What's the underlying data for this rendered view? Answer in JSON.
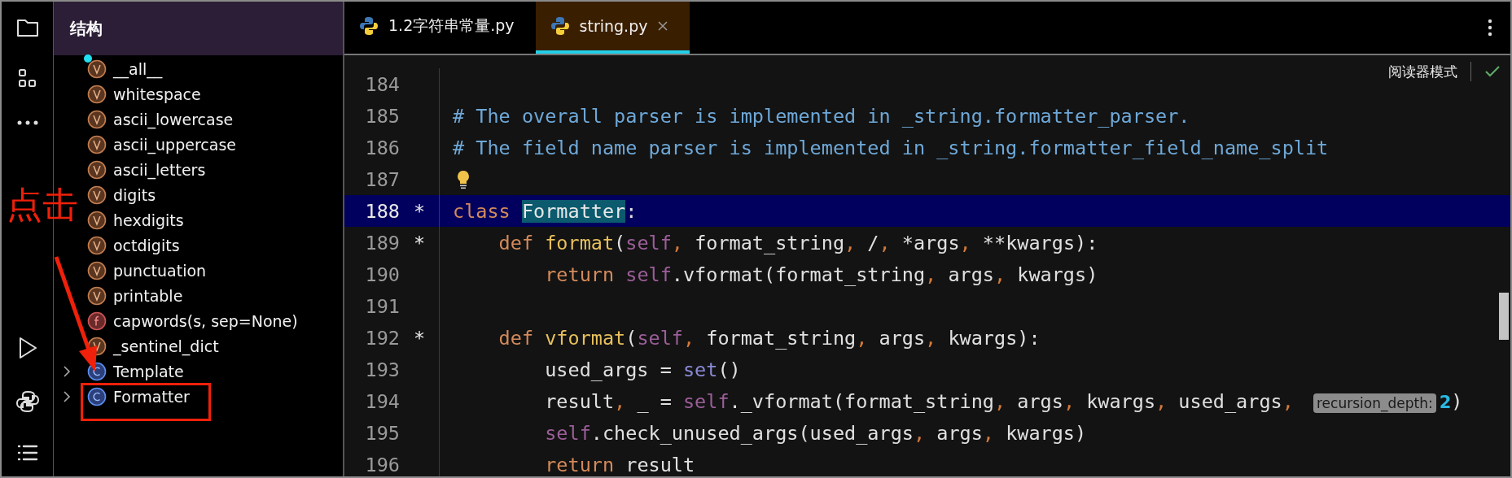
{
  "activity_bar": [
    {
      "kind": "folder"
    },
    {
      "kind": "structure"
    },
    {
      "kind": "more"
    },
    {
      "kind": "run"
    },
    {
      "kind": "python"
    },
    {
      "kind": "list"
    }
  ],
  "structure_panel": {
    "title": "结构",
    "items": [
      {
        "kind": "variable",
        "label": "__all__",
        "marked": true
      },
      {
        "kind": "variable",
        "label": "whitespace",
        "marked": false
      },
      {
        "kind": "variable",
        "label": "ascii_lowercase",
        "marked": false
      },
      {
        "kind": "variable",
        "label": "ascii_uppercase",
        "marked": false
      },
      {
        "kind": "variable",
        "label": "ascii_letters",
        "marked": false
      },
      {
        "kind": "variable",
        "label": "digits",
        "marked": false
      },
      {
        "kind": "variable",
        "label": "hexdigits",
        "marked": false
      },
      {
        "kind": "variable",
        "label": "octdigits",
        "marked": false
      },
      {
        "kind": "variable",
        "label": "punctuation",
        "marked": false
      },
      {
        "kind": "variable",
        "label": "printable",
        "marked": false
      },
      {
        "kind": "function",
        "label": "capwords(s, sep=None)",
        "marked": false
      },
      {
        "kind": "variable",
        "label": "_sentinel_dict",
        "marked": false
      },
      {
        "kind": "class",
        "label": "Template",
        "marked": false,
        "expanded": false
      },
      {
        "kind": "class",
        "label": "Formatter",
        "marked": false,
        "expanded": false
      }
    ]
  },
  "tabs": [
    {
      "label": "1.2字符串常量.py",
      "selected": false
    },
    {
      "label": "string.py",
      "selected": true
    }
  ],
  "reader_mode": {
    "label": "阅读器模式"
  },
  "code_lines": [
    {
      "number": "184",
      "current": false,
      "bulb": false
    },
    {
      "number": "185",
      "current": false,
      "bulb": false,
      "segments": [
        {
          "kind": "comment",
          "text": "# The overall parser is implemented in _string.formatter_parser."
        }
      ]
    },
    {
      "number": "186",
      "current": false,
      "bulb": false,
      "segments": [
        {
          "kind": "comment",
          "text": "# The field name parser is implemented in _string.formatter_field_name_split"
        }
      ]
    },
    {
      "number": "187",
      "current": false,
      "bulb": true
    },
    {
      "number": "188",
      "marker": "*",
      "current": true,
      "bulb": false,
      "segments": [
        {
          "kind": "keyword",
          "text": "class "
        },
        {
          "kind": "match",
          "text": "Formatter"
        },
        {
          "kind": "plain",
          "text": ":"
        }
      ]
    },
    {
      "number": "189",
      "marker": "*",
      "current": false,
      "bulb": false,
      "segments": [
        {
          "kind": "keyword",
          "text": "    def "
        },
        {
          "kind": "func",
          "text": "format"
        },
        {
          "kind": "plain",
          "text": "("
        },
        {
          "kind": "self",
          "text": "self"
        },
        {
          "kind": "punct",
          "text": ", "
        },
        {
          "kind": "plain",
          "text": "format_string"
        },
        {
          "kind": "punct",
          "text": ", "
        },
        {
          "kind": "plain",
          "text": "/"
        },
        {
          "kind": "punct",
          "text": ", "
        },
        {
          "kind": "plain",
          "text": "*args"
        },
        {
          "kind": "punct",
          "text": ", "
        },
        {
          "kind": "plain",
          "text": "**kwargs):"
        }
      ]
    },
    {
      "number": "190",
      "current": false,
      "bulb": false,
      "segments": [
        {
          "kind": "keyword",
          "text": "        return "
        },
        {
          "kind": "self",
          "text": "self"
        },
        {
          "kind": "plain",
          "text": ".vformat(format_string"
        },
        {
          "kind": "punct",
          "text": ", "
        },
        {
          "kind": "plain",
          "text": "args"
        },
        {
          "kind": "punct",
          "text": ", "
        },
        {
          "kind": "plain",
          "text": "kwargs)"
        }
      ]
    },
    {
      "number": "191",
      "current": false,
      "bulb": false
    },
    {
      "number": "192",
      "marker": "*",
      "current": false,
      "bulb": false,
      "segments": [
        {
          "kind": "keyword",
          "text": "    def "
        },
        {
          "kind": "func",
          "text": "vformat"
        },
        {
          "kind": "plain",
          "text": "("
        },
        {
          "kind": "self",
          "text": "self"
        },
        {
          "kind": "punct",
          "text": ", "
        },
        {
          "kind": "plain",
          "text": "format_string"
        },
        {
          "kind": "punct",
          "text": ", "
        },
        {
          "kind": "plain",
          "text": "args"
        },
        {
          "kind": "punct",
          "text": ", "
        },
        {
          "kind": "plain",
          "text": "kwargs):"
        }
      ]
    },
    {
      "number": "193",
      "current": false,
      "bulb": false,
      "segments": [
        {
          "kind": "plain",
          "text": "        used_args = "
        },
        {
          "kind": "builtin",
          "text": "set"
        },
        {
          "kind": "plain",
          "text": "()"
        }
      ]
    },
    {
      "number": "194",
      "current": false,
      "bulb": false,
      "segments": [
        {
          "kind": "plain",
          "text": "        result"
        },
        {
          "kind": "punct",
          "text": ", "
        },
        {
          "kind": "plain",
          "text": "_ = "
        },
        {
          "kind": "self",
          "text": "self"
        },
        {
          "kind": "plain",
          "text": "._vformat(format_string"
        },
        {
          "kind": "punct",
          "text": ", "
        },
        {
          "kind": "plain",
          "text": "args"
        },
        {
          "kind": "punct",
          "text": ", "
        },
        {
          "kind": "plain",
          "text": "kwargs"
        },
        {
          "kind": "punct",
          "text": ", "
        },
        {
          "kind": "plain",
          "text": "used_args"
        },
        {
          "kind": "punct",
          "text": ", "
        },
        {
          "kind": "hint",
          "text": "recursion_depth:"
        },
        {
          "kind": "number",
          "text": "2"
        },
        {
          "kind": "plain",
          "text": ")"
        }
      ]
    },
    {
      "number": "195",
      "current": false,
      "bulb": false,
      "segments": [
        {
          "kind": "self",
          "text": "        self"
        },
        {
          "kind": "plain",
          "text": ".check_unused_args(used_args"
        },
        {
          "kind": "punct",
          "text": ", "
        },
        {
          "kind": "plain",
          "text": "args"
        },
        {
          "kind": "punct",
          "text": ", "
        },
        {
          "kind": "plain",
          "text": "kwargs)"
        }
      ]
    },
    {
      "number": "196",
      "current": false,
      "bulb": false,
      "segments": [
        {
          "kind": "keyword",
          "text": "        return "
        },
        {
          "kind": "plain",
          "text": "result"
        }
      ]
    }
  ],
  "annotation": {
    "label": "点击"
  }
}
